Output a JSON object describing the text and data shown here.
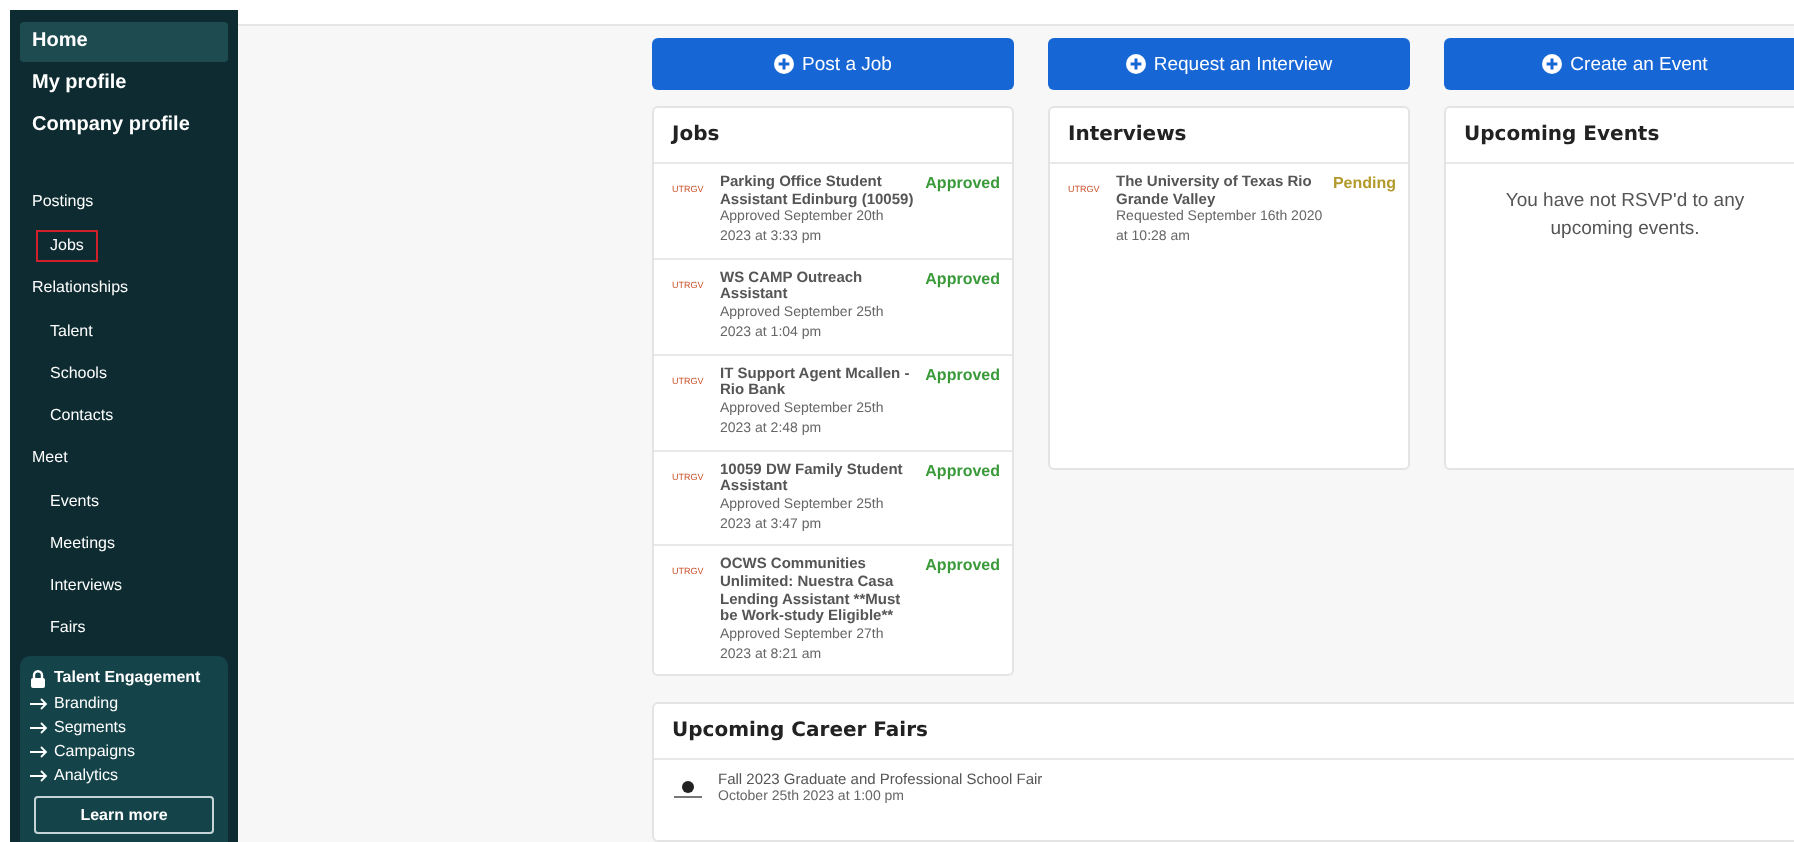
{
  "sidebar": {
    "items": [
      {
        "label": "Home",
        "kind": "top",
        "selected": true,
        "highlighted": false
      },
      {
        "label": "My profile",
        "kind": "top",
        "selected": false,
        "highlighted": false
      },
      {
        "label": "Company profile",
        "kind": "top",
        "selected": false,
        "highlighted": false
      },
      {
        "label": "Postings",
        "kind": "section",
        "selected": false,
        "highlighted": false
      },
      {
        "label": "Jobs",
        "kind": "sub",
        "selected": false,
        "highlighted": true
      },
      {
        "label": "Relationships",
        "kind": "section",
        "selected": false,
        "highlighted": false
      },
      {
        "label": "Talent",
        "kind": "sub",
        "selected": false,
        "highlighted": false
      },
      {
        "label": "Schools",
        "kind": "sub",
        "selected": false,
        "highlighted": false
      },
      {
        "label": "Contacts",
        "kind": "sub",
        "selected": false,
        "highlighted": false
      },
      {
        "label": "Meet",
        "kind": "section",
        "selected": false,
        "highlighted": false
      },
      {
        "label": "Events",
        "kind": "sub",
        "selected": false,
        "highlighted": false
      },
      {
        "label": "Meetings",
        "kind": "sub",
        "selected": false,
        "highlighted": false
      },
      {
        "label": "Interviews",
        "kind": "sub",
        "selected": false,
        "highlighted": false
      },
      {
        "label": "Fairs",
        "kind": "sub",
        "selected": false,
        "highlighted": false
      }
    ],
    "engagement": {
      "title": "Talent Engagement",
      "links": [
        "Branding",
        "Segments",
        "Campaigns",
        "Analytics"
      ],
      "button": "Learn more"
    }
  },
  "columns": [
    {
      "button": "Post a Job",
      "title": "Jobs",
      "items": [
        {
          "logo": "UTRGV",
          "title": "Parking Office Student Assistant Edinburg (10059)",
          "meta": "Approved September 20th 2023 at 3:33 pm",
          "status": "Approved",
          "kind": "approved"
        },
        {
          "logo": "UTRGV",
          "title": "WS CAMP Outreach Assistant",
          "meta": "Approved September 25th 2023 at 1:04 pm",
          "status": "Approved",
          "kind": "approved"
        },
        {
          "logo": "UTRGV",
          "title": "IT Support Agent Mcallen - Rio Bank",
          "meta": "Approved September 25th 2023 at 2:48 pm",
          "status": "Approved",
          "kind": "approved"
        },
        {
          "logo": "UTRGV",
          "title": "10059 DW Family Student Assistant",
          "meta": "Approved September 25th 2023 at 3:47 pm",
          "status": "Approved",
          "kind": "approved"
        },
        {
          "logo": "UTRGV",
          "title": "OCWS Communities Unlimited: Nuestra Casa Lending Assistant **Must be Work-study Eligible**",
          "meta": "Approved September 27th 2023 at 8:21 am",
          "status": "Approved",
          "kind": "approved"
        }
      ]
    },
    {
      "button": "Request an Interview",
      "title": "Interviews",
      "items": [
        {
          "logo": "UTRGV",
          "title": "The University of Texas Rio Grande Valley",
          "meta": "Requested September 16th 2020 at 10:28 am",
          "status": "Pending",
          "kind": "pending"
        }
      ]
    },
    {
      "button": "Create an Event",
      "title": "Upcoming Events",
      "empty": "You have not RSVP'd to any upcoming events."
    }
  ],
  "career_fairs": {
    "title": "Upcoming Career Fairs",
    "items": [
      {
        "title": "Fall 2023 Graduate and Professional School Fair",
        "meta": "October 25th 2023 at 1:00 pm"
      }
    ]
  }
}
